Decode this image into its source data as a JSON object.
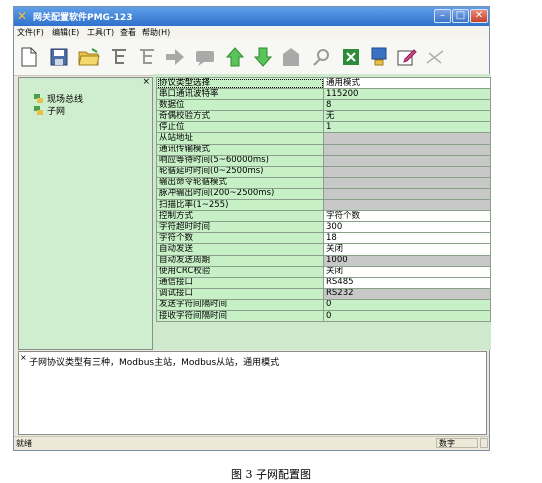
{
  "window": {
    "title": "网关配置软件PMG-123",
    "controls": {
      "minimize": "–",
      "maximize": "□",
      "close": "✕"
    }
  },
  "menu": [
    {
      "label": "文件(F)"
    },
    {
      "label": "编辑(E)"
    },
    {
      "label": "工具(T)"
    },
    {
      "label": "查看"
    },
    {
      "label": "帮助(H)"
    }
  ],
  "toolbar": {
    "icons": [
      "new-file-icon",
      "save-icon",
      "open-folder-icon",
      "tree-add-icon",
      "tree-remove-icon",
      "arrow-right-icon",
      "message-icon",
      "arrow-up-icon",
      "arrow-down-icon",
      "shape-icon",
      "tools-icon",
      "excel-icon",
      "download-icon",
      "edit-icon",
      "cut-icon"
    ]
  },
  "tree": {
    "close": "×",
    "items": [
      {
        "label": "现场总线"
      },
      {
        "label": "子网"
      }
    ]
  },
  "properties": [
    {
      "name": "协议类型选择",
      "value": "通用模式",
      "state": "white",
      "selected": true
    },
    {
      "name": "串口通讯波特率",
      "value": "115200",
      "state": "green"
    },
    {
      "name": "数据位",
      "value": "8",
      "state": "green"
    },
    {
      "name": "奇偶校验方式",
      "value": "无",
      "state": "green"
    },
    {
      "name": "停止位",
      "value": "1",
      "state": "green"
    },
    {
      "name": "从站地址",
      "value": "",
      "state": "gray"
    },
    {
      "name": "通讯传输模式",
      "value": "",
      "state": "gray"
    },
    {
      "name": "响应等待时间(5~60000ms)",
      "value": "",
      "state": "gray"
    },
    {
      "name": "轮循延时时间(0~2500ms)",
      "value": "",
      "state": "gray"
    },
    {
      "name": "输出命令轮循模式",
      "value": "",
      "state": "gray"
    },
    {
      "name": "脉冲输出时间(200~2500ms)",
      "value": "",
      "state": "gray"
    },
    {
      "name": "扫描比率(1~255)",
      "value": "",
      "state": "gray"
    },
    {
      "name": "控制方式",
      "value": "字符个数",
      "state": "white"
    },
    {
      "name": "字符超时时间",
      "value": "300",
      "state": "white"
    },
    {
      "name": "字符个数",
      "value": "18",
      "state": "white"
    },
    {
      "name": "自动发送",
      "value": "关闭",
      "state": "white"
    },
    {
      "name": "自动发送周期",
      "value": "1000",
      "state": "gray"
    },
    {
      "name": "使用CRC校验",
      "value": "关闭",
      "state": "white"
    },
    {
      "name": "通信接口",
      "value": "RS485",
      "state": "white"
    },
    {
      "name": "调试接口",
      "value": "RS232",
      "state": "gray"
    },
    {
      "name": "发送字符间隔时间",
      "value": "0",
      "state": "green"
    },
    {
      "name": "接收字符间隔时间",
      "value": "0",
      "state": "green"
    }
  ],
  "description": {
    "close": "×",
    "text": "子网协议类型有三种，Modbus主站，Modbus从站，通用模式"
  },
  "status": {
    "text": "就绪",
    "cell": "数字"
  },
  "caption": "图 3    子网配置图"
}
